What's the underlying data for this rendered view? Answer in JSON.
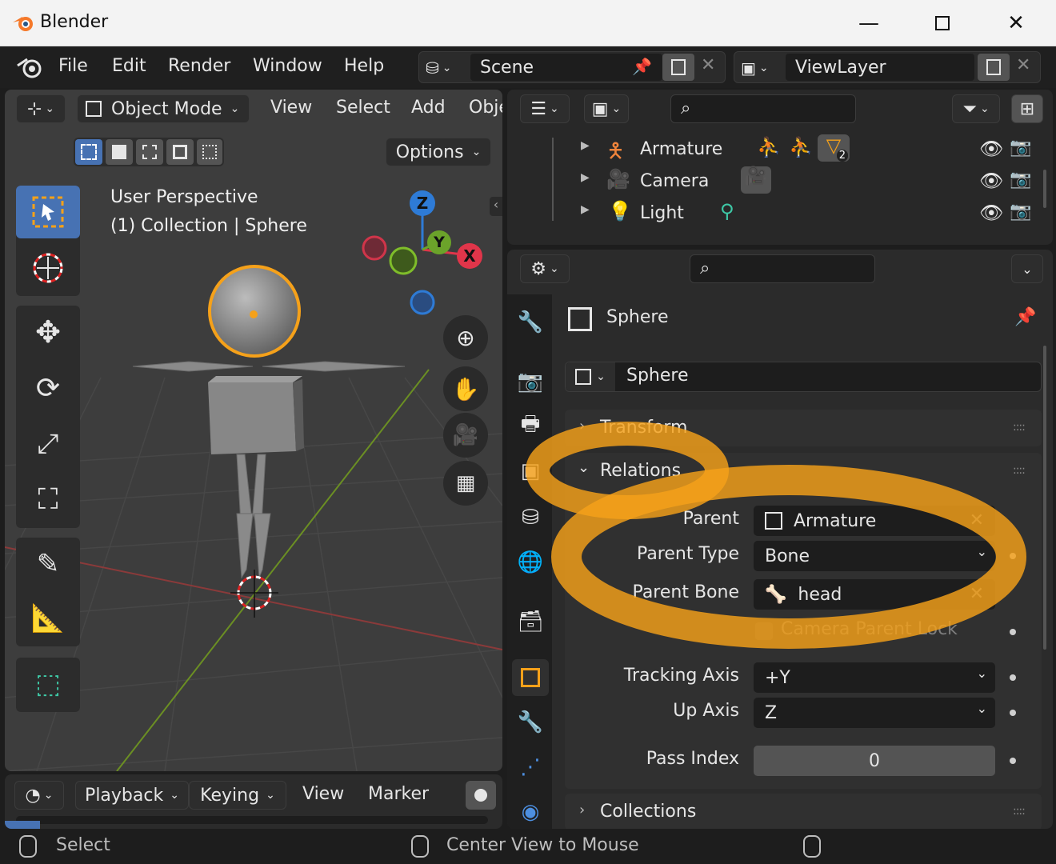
{
  "window": {
    "title": "Blender"
  },
  "menu": [
    "File",
    "Edit",
    "Render",
    "Window",
    "Help"
  ],
  "scene_field": "Scene",
  "viewlayer_field": "ViewLayer",
  "viewport": {
    "mode": "Object Mode",
    "menus": [
      "View",
      "Select",
      "Add",
      "Obje"
    ],
    "options_label": "Options",
    "overlay_title": "User Perspective",
    "overlay_subtitle": "(1) Collection | Sphere",
    "gizmo": {
      "z": "Z",
      "y": "Y",
      "x": "X"
    }
  },
  "outliner": {
    "rows": [
      {
        "name": "Armature",
        "badge": "2"
      },
      {
        "name": "Camera"
      },
      {
        "name": "Light"
      }
    ]
  },
  "properties": {
    "object_header": "Sphere",
    "object_name_field": "Sphere",
    "panels": {
      "transform": "Transform",
      "relations": "Relations",
      "collections": "Collections"
    },
    "relations": {
      "parent_label": "Parent",
      "parent_value": "Armature",
      "parent_type_label": "Parent Type",
      "parent_type_value": "Bone",
      "parent_bone_label": "Parent Bone",
      "parent_bone_value": "head",
      "camera_parent_lock": "Camera Parent Lock",
      "tracking_axis_label": "Tracking Axis",
      "tracking_axis_value": "+Y",
      "up_axis_label": "Up Axis",
      "up_axis_value": "Z",
      "pass_index_label": "Pass Index",
      "pass_index_value": "0"
    }
  },
  "timeline": {
    "menus": [
      "Playback",
      "Keying",
      "View",
      "Marker"
    ]
  },
  "statusbar": {
    "left": "Select",
    "middle": "Center View to Mouse"
  },
  "colors": {
    "accent_orange": "#f5a11a",
    "active_blue": "#4772b3",
    "teal": "#3ec8a6"
  }
}
